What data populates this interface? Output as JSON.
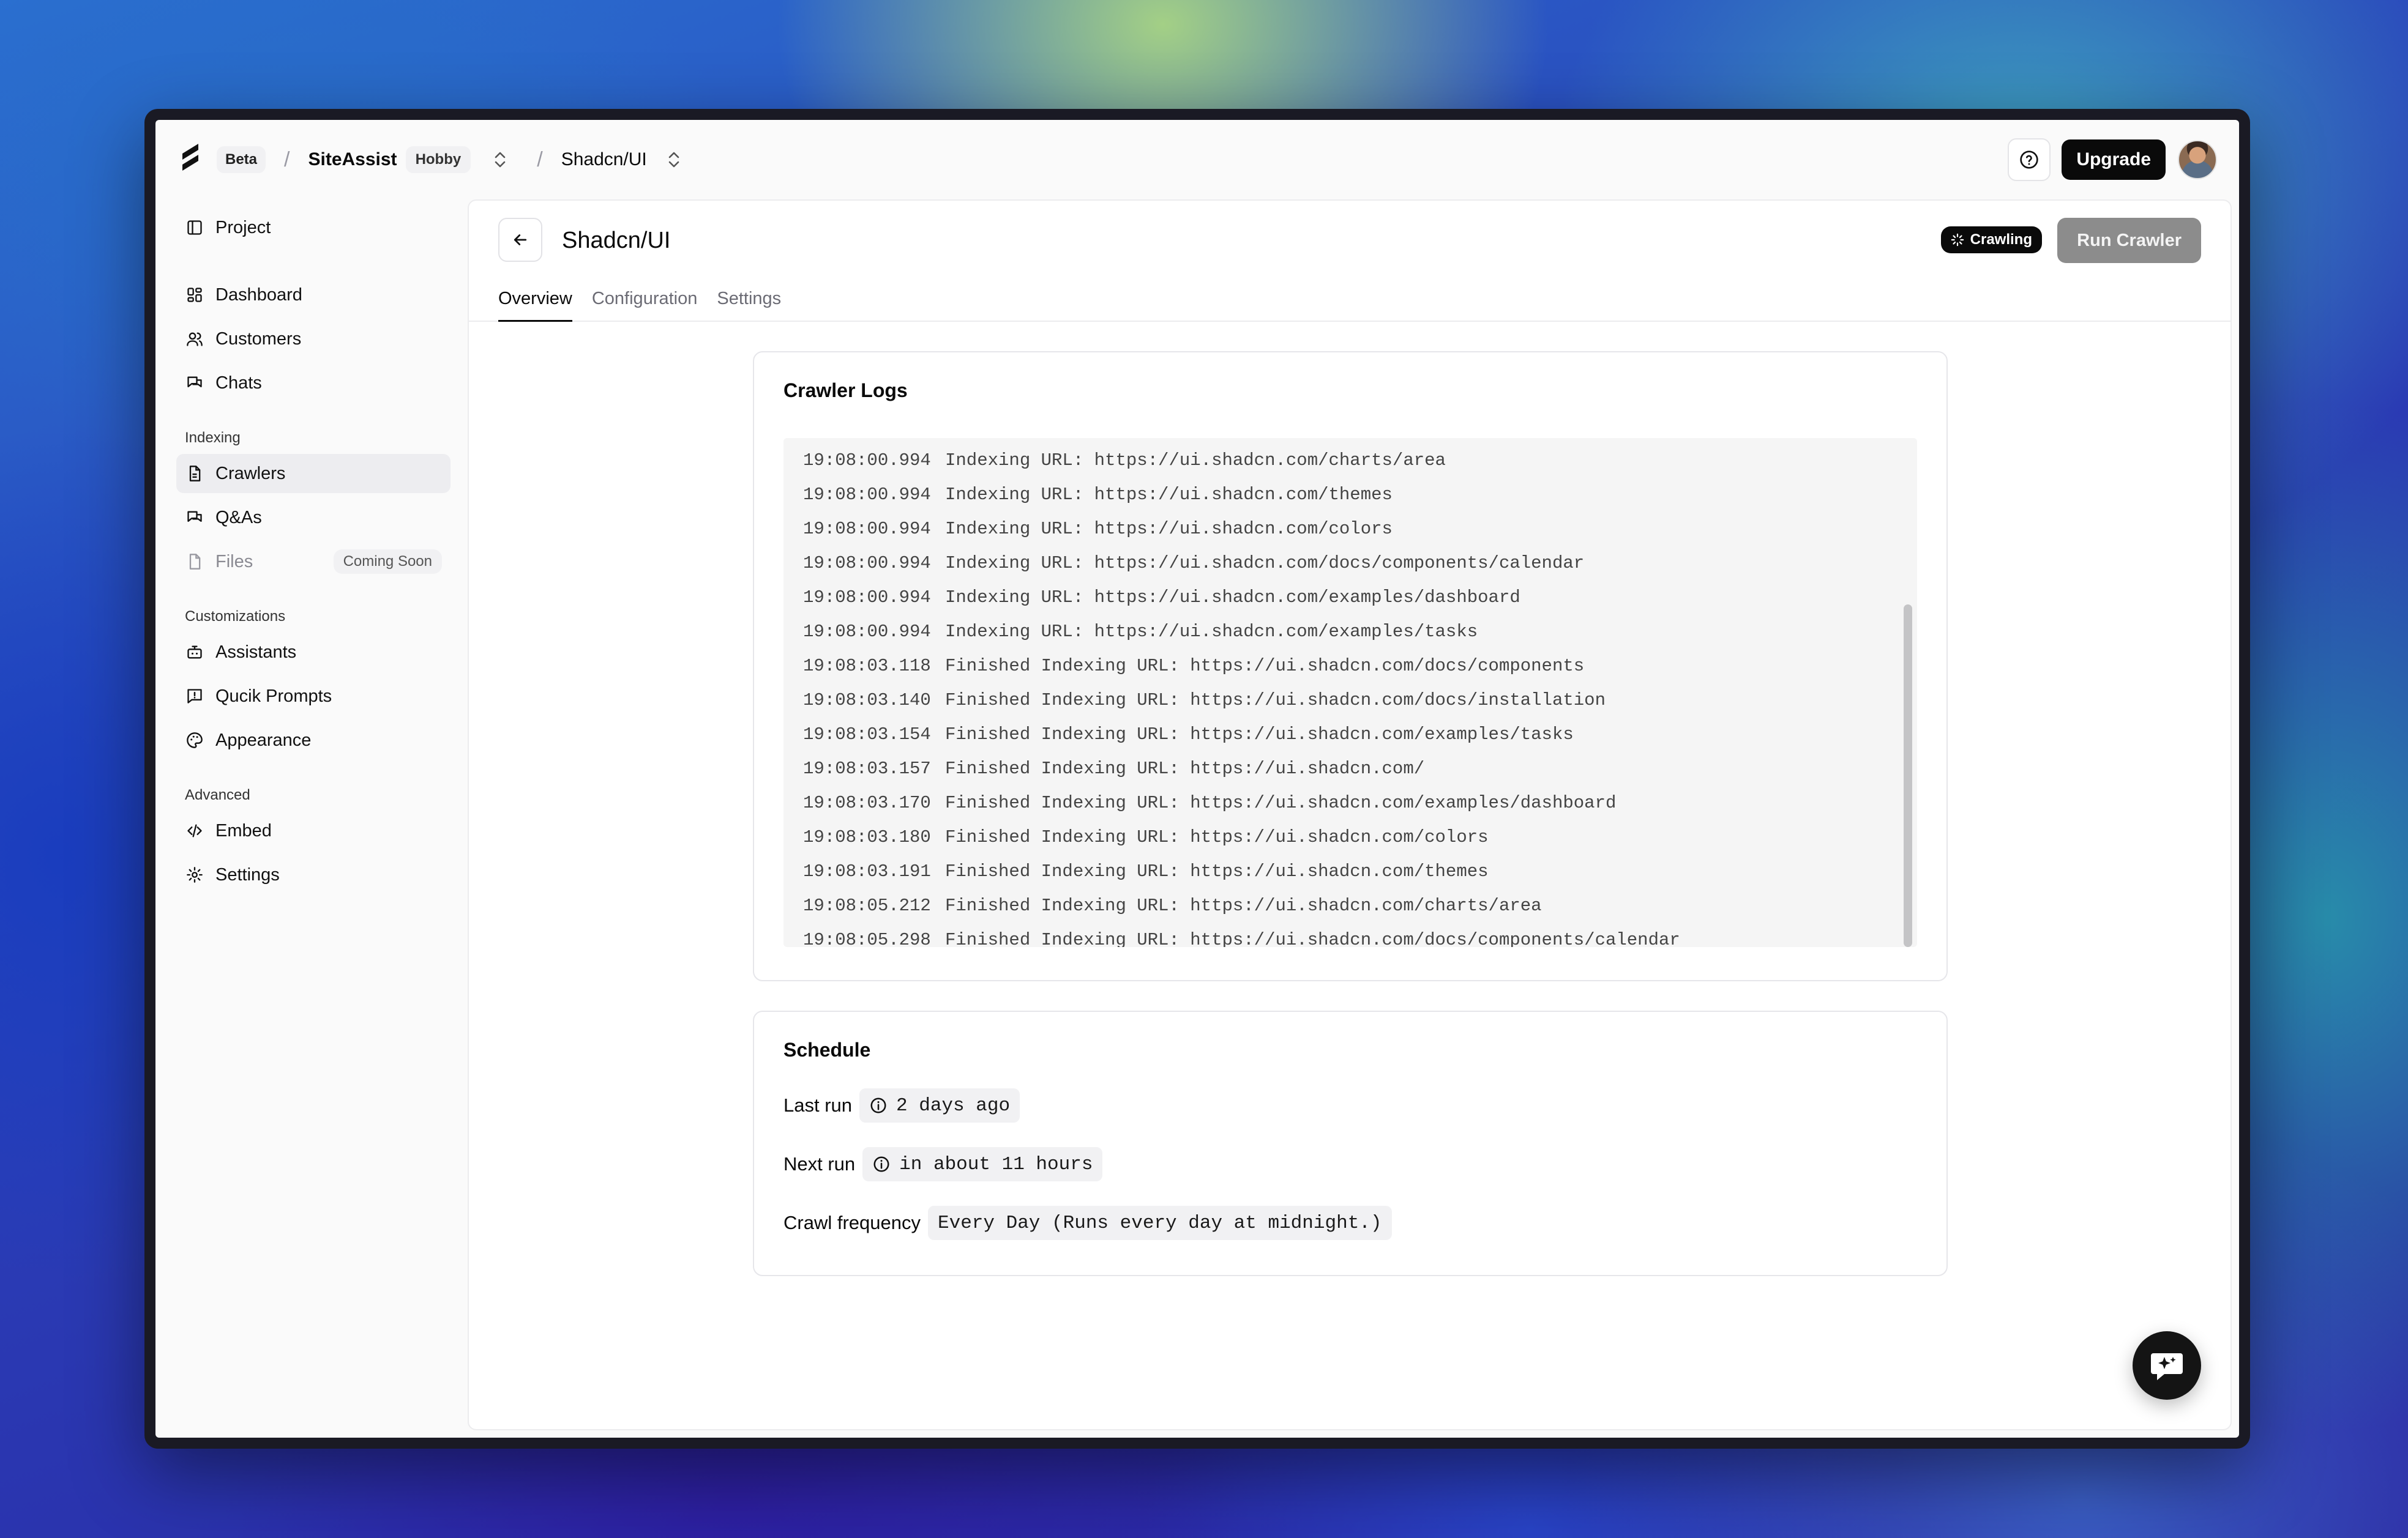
{
  "topbar": {
    "beta_label": "Beta",
    "separator": "/",
    "org_name": "SiteAssist",
    "plan_label": "Hobby",
    "project_name": "Shadcn/UI",
    "upgrade_label": "Upgrade"
  },
  "sidebar": {
    "project_label": "Project",
    "main_items": [
      {
        "label": "Dashboard",
        "icon": "grid-icon"
      },
      {
        "label": "Customers",
        "icon": "users-icon"
      },
      {
        "label": "Chats",
        "icon": "chat-icon"
      }
    ],
    "indexing_heading": "Indexing",
    "indexing_items": [
      {
        "label": "Crawlers",
        "icon": "document-icon",
        "active": true
      },
      {
        "label": "Q&As",
        "icon": "chat-icon"
      },
      {
        "label": "Files",
        "icon": "file-icon",
        "disabled": true,
        "badge": "Coming Soon"
      }
    ],
    "customizations_heading": "Customizations",
    "customizations_items": [
      {
        "label": "Assistants",
        "icon": "bot-icon"
      },
      {
        "label": "Qucik Prompts",
        "icon": "prompt-icon"
      },
      {
        "label": "Appearance",
        "icon": "palette-icon"
      }
    ],
    "advanced_heading": "Advanced",
    "advanced_items": [
      {
        "label": "Embed",
        "icon": "code-icon"
      },
      {
        "label": "Settings",
        "icon": "gear-icon"
      }
    ]
  },
  "main": {
    "title": "Shadcn/UI",
    "status": "Crawling",
    "run_button": "Run Crawler",
    "tabs": [
      "Overview",
      "Configuration",
      "Settings"
    ],
    "active_tab": 0
  },
  "logs": {
    "title": "Crawler Logs",
    "entries": [
      {
        "time": "19:08:00.994",
        "message": "Indexing URL: https://ui.shadcn.com/charts/area"
      },
      {
        "time": "19:08:00.994",
        "message": "Indexing URL: https://ui.shadcn.com/themes"
      },
      {
        "time": "19:08:00.994",
        "message": "Indexing URL: https://ui.shadcn.com/colors"
      },
      {
        "time": "19:08:00.994",
        "message": "Indexing URL: https://ui.shadcn.com/docs/components/calendar"
      },
      {
        "time": "19:08:00.994",
        "message": "Indexing URL: https://ui.shadcn.com/examples/dashboard"
      },
      {
        "time": "19:08:00.994",
        "message": "Indexing URL: https://ui.shadcn.com/examples/tasks"
      },
      {
        "time": "19:08:03.118",
        "message": "Finished Indexing URL: https://ui.shadcn.com/docs/components"
      },
      {
        "time": "19:08:03.140",
        "message": "Finished Indexing URL: https://ui.shadcn.com/docs/installation"
      },
      {
        "time": "19:08:03.154",
        "message": "Finished Indexing URL: https://ui.shadcn.com/examples/tasks"
      },
      {
        "time": "19:08:03.157",
        "message": "Finished Indexing URL: https://ui.shadcn.com/"
      },
      {
        "time": "19:08:03.170",
        "message": "Finished Indexing URL: https://ui.shadcn.com/examples/dashboard"
      },
      {
        "time": "19:08:03.180",
        "message": "Finished Indexing URL: https://ui.shadcn.com/colors"
      },
      {
        "time": "19:08:03.191",
        "message": "Finished Indexing URL: https://ui.shadcn.com/themes"
      },
      {
        "time": "19:08:05.212",
        "message": "Finished Indexing URL: https://ui.shadcn.com/charts/area"
      },
      {
        "time": "19:08:05.298",
        "message": "Finished Indexing URL: https://ui.shadcn.com/docs/components/calendar"
      }
    ]
  },
  "schedule": {
    "title": "Schedule",
    "last_run_label": "Last run",
    "last_run_value": "2 days ago",
    "next_run_label": "Next run",
    "next_run_value": "in about 11 hours",
    "frequency_label": "Crawl frequency",
    "frequency_value": "Every Day (Runs every day at midnight.)"
  },
  "colors": {
    "accent": "#0a0a0a",
    "run_button_disabled": "#8c8c8c",
    "active_nav": "#ededf0"
  }
}
